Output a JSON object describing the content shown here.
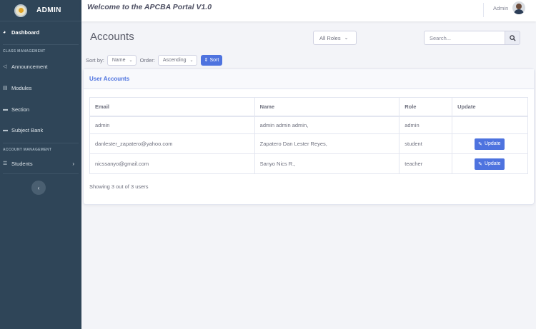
{
  "sidebar": {
    "brand": "ADMIN",
    "items": {
      "dashboard": "Dashboard",
      "class_heading": "CLASS MANAGEMENT",
      "announcement": "Announcement",
      "modules": "Modules",
      "section": "Section",
      "subject_bank": "Subject Bank",
      "account_heading": "ACCOUNT MANAGEMENT",
      "students": "Students"
    },
    "collapse_glyph": "‹"
  },
  "topbar": {
    "welcome": "Welcome to the APCBA Portal V1.0",
    "user": "Admin"
  },
  "main": {
    "title": "Accounts",
    "role_filter": "All Roles",
    "search_placeholder": "Search...",
    "sort_by_label": "Sort by:",
    "sort_by_value": "Name",
    "order_label": "Order:",
    "order_value": "Ascending",
    "sort_button": "Sort"
  },
  "card": {
    "header": "User Accounts",
    "columns": [
      "Email",
      "Name",
      "Role",
      "Update"
    ],
    "rows": [
      {
        "email": "admin",
        "name": "admin admin admin,",
        "role": "admin",
        "update": ""
      },
      {
        "email": "danlester_zapatero@yahoo.com",
        "name": "Zapatero Dan Lester Reyes,",
        "role": "student",
        "update": "Update"
      },
      {
        "email": "nicssanyo@gmail.com",
        "name": "Sanyo Nics R.,",
        "role": "teacher",
        "update": "Update"
      }
    ],
    "footer": "Showing 3 out of 3 users"
  },
  "colors": {
    "sidebar": "#2f4558",
    "accent": "#4e73df"
  }
}
